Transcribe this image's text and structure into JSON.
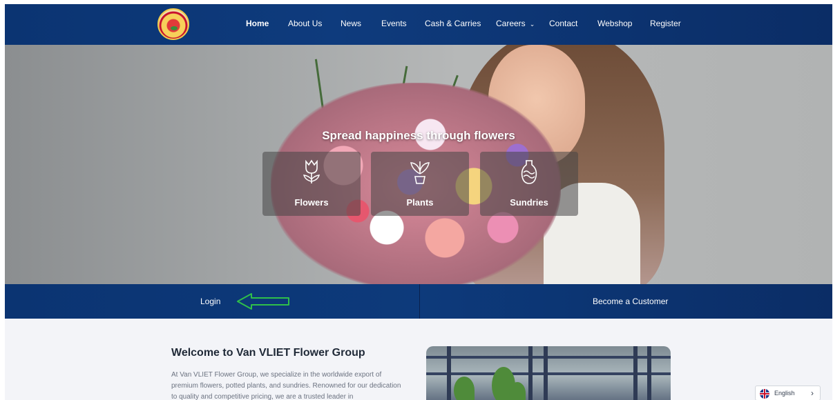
{
  "header": {
    "nav": [
      {
        "label": "Home",
        "active": true
      },
      {
        "label": "About Us"
      },
      {
        "label": "News"
      },
      {
        "label": "Events"
      },
      {
        "label": "Cash & Carries"
      },
      {
        "label": "Careers",
        "has_dropdown": true,
        "caret": "⌄"
      },
      {
        "label": "Contact"
      },
      {
        "label": "Webshop"
      },
      {
        "label": "Register"
      }
    ]
  },
  "hero": {
    "title": "Spread happiness through flowers",
    "categories": [
      {
        "label": "Flowers",
        "icon": "tulip-icon"
      },
      {
        "label": "Plants",
        "icon": "potted-plant-icon"
      },
      {
        "label": "Sundries",
        "icon": "vase-icon"
      }
    ]
  },
  "actions": {
    "login": "Login",
    "become_customer": "Become a Customer"
  },
  "welcome": {
    "title": "Welcome to Van VLIET Flower Group",
    "text": "At Van VLIET Flower Group, we specialize in the worldwide export of premium flowers, potted plants, and sundries. Renowned for our dedication to quality and competitive pricing, we are a trusted leader in"
  },
  "language": {
    "label": "English",
    "chevron": "›"
  },
  "colors": {
    "navy": "#0b3472",
    "annotation_arrow": "#2fbf4a"
  }
}
